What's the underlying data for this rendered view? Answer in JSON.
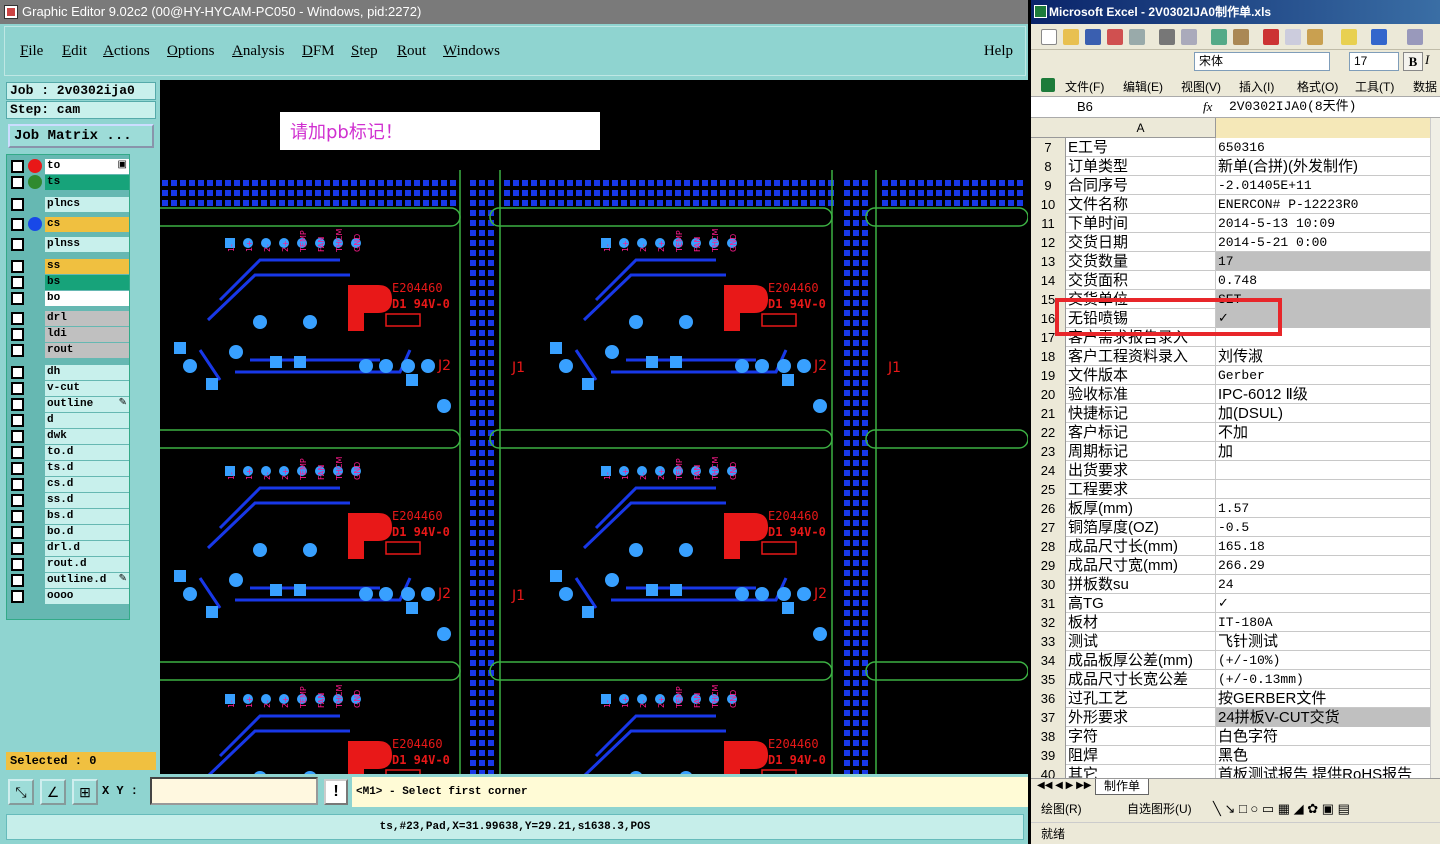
{
  "ge": {
    "title": "Graphic Editor 9.02c2 (00@HY-HYCAM-PC050 - Windows, pid:2272)",
    "menu": [
      "File",
      "Edit",
      "Actions",
      "Options",
      "Analysis",
      "DFM",
      "Step",
      "Rout",
      "Windows"
    ],
    "help": "Help",
    "job": "Job : 2v0302ija0",
    "step": "Step: cam",
    "job_matrix": "Job Matrix ...",
    "layers": [
      {
        "name": "to",
        "color": "#ffffff",
        "dot": "#e81818",
        "mark": "▣"
      },
      {
        "name": "ts",
        "color": "#17a37a",
        "dot": "#2f8a2f",
        "mark": ""
      },
      {
        "name": "plncs",
        "color": "#c8f0ec",
        "dot": "",
        "mark": ""
      },
      {
        "name": "cs",
        "color": "#f0c040",
        "dot": "#1848e8",
        "mark": ""
      },
      {
        "name": "plnss",
        "color": "#c8f0ec",
        "dot": "",
        "mark": ""
      },
      {
        "name": "ss",
        "color": "#f0c040",
        "dot": "",
        "mark": ""
      },
      {
        "name": "bs",
        "color": "#17a37a",
        "dot": "",
        "mark": ""
      },
      {
        "name": "bo",
        "color": "#ffffff",
        "dot": "",
        "mark": ""
      },
      {
        "name": "drl",
        "color": "#c0c0c0",
        "dot": "",
        "mark": ""
      },
      {
        "name": "ldi",
        "color": "#c0c0c0",
        "dot": "",
        "mark": ""
      },
      {
        "name": "rout",
        "color": "#c0c0c0",
        "dot": "",
        "mark": ""
      },
      {
        "name": "dh",
        "color": "#c8f0ec",
        "dot": "",
        "mark": ""
      },
      {
        "name": "v-cut",
        "color": "#c8f0ec",
        "dot": "",
        "mark": ""
      },
      {
        "name": "outline",
        "color": "#c8f0ec",
        "dot": "",
        "mark": "✎"
      },
      {
        "name": "d",
        "color": "#c8f0ec",
        "dot": "",
        "mark": ""
      },
      {
        "name": "dwk",
        "color": "#c8f0ec",
        "dot": "",
        "mark": ""
      },
      {
        "name": "to.d",
        "color": "#c8f0ec",
        "dot": "",
        "mark": ""
      },
      {
        "name": "ts.d",
        "color": "#c8f0ec",
        "dot": "",
        "mark": ""
      },
      {
        "name": "cs.d",
        "color": "#c8f0ec",
        "dot": "",
        "mark": ""
      },
      {
        "name": "ss.d",
        "color": "#c8f0ec",
        "dot": "",
        "mark": ""
      },
      {
        "name": "bs.d",
        "color": "#c8f0ec",
        "dot": "",
        "mark": ""
      },
      {
        "name": "bo.d",
        "color": "#c8f0ec",
        "dot": "",
        "mark": ""
      },
      {
        "name": "drl.d",
        "color": "#c8f0ec",
        "dot": "",
        "mark": ""
      },
      {
        "name": "rout.d",
        "color": "#c8f0ec",
        "dot": "",
        "mark": ""
      },
      {
        "name": "outline.d",
        "color": "#c8f0ec",
        "dot": "",
        "mark": "✎"
      },
      {
        "name": "oooo",
        "color": "#c8f0ec",
        "dot": "",
        "mark": ""
      }
    ],
    "selected": "Selected : 0",
    "note": "请加pb标记！",
    "pcb": {
      "text1": "E204460",
      "text2": "D1 94V-0",
      "j1": "J1",
      "j2": "J2",
      "pins": [
        "1-",
        "1+",
        "2-",
        "2+",
        "TEMP",
        "FAN",
        "THCM",
        "GND"
      ]
    },
    "xy_label": "X Y :",
    "xy_value": "",
    "bang": "!",
    "prompt": "<M1> - Select first corner",
    "status": "ts,#23,Pad,X=31.99638,Y=29.21,s1638.3,POS"
  },
  "xl": {
    "title": "Microsoft Excel - 2V0302IJA0制作单.xls",
    "font_name": "宋体",
    "font_size": "17",
    "bold": "B",
    "italic": "I",
    "menu": [
      "文件(F)",
      "编辑(E)",
      "视图(V)",
      "插入(I)",
      "格式(O)",
      "工具(T)",
      "数据"
    ],
    "name_box": "B6",
    "fx": "fx",
    "formula": "2V0302IJA0(8天件)",
    "col_a": "A",
    "rows": [
      {
        "n": "7",
        "a": "E工号",
        "b": "650316"
      },
      {
        "n": "8",
        "a": "订单类型",
        "b": "新单(合拼)(外发制作)"
      },
      {
        "n": "9",
        "a": "合同序号",
        "b": "-2.01405E+11"
      },
      {
        "n": "10",
        "a": "文件名称",
        "b": "ENERCON# P-12223R0"
      },
      {
        "n": "11",
        "a": "下单时间",
        "b": "2014-5-13 10:09"
      },
      {
        "n": "12",
        "a": "交货日期",
        "b": "2014-5-21 0:00"
      },
      {
        "n": "13",
        "a": "交货数量",
        "b": "17"
      },
      {
        "n": "14",
        "a": "交货面积",
        "b": "0.748"
      },
      {
        "n": "15",
        "a": "交货单位",
        "b": "SET"
      },
      {
        "n": "16",
        "a": "无铅喷锡",
        "b": "✓"
      },
      {
        "n": "17",
        "a": "客户需求报告录入",
        "b": ""
      },
      {
        "n": "18",
        "a": "客户工程资料录入",
        "b": "刘传淑"
      },
      {
        "n": "19",
        "a": "文件版本",
        "b": "Gerber"
      },
      {
        "n": "20",
        "a": "验收标准",
        "b": "IPC-6012 Ⅱ级"
      },
      {
        "n": "21",
        "a": "快捷标记",
        "b": "加(DSUL)"
      },
      {
        "n": "22",
        "a": "客户标记",
        "b": "不加"
      },
      {
        "n": "23",
        "a": "周期标记",
        "b": "加"
      },
      {
        "n": "24",
        "a": "出货要求",
        "b": ""
      },
      {
        "n": "25",
        "a": "工程要求",
        "b": ""
      },
      {
        "n": "26",
        "a": "板厚(mm)",
        "b": "1.57"
      },
      {
        "n": "27",
        "a": "铜箔厚度(OZ)",
        "b": "-0.5"
      },
      {
        "n": "28",
        "a": "成品尺寸长(mm)",
        "b": "165.18"
      },
      {
        "n": "29",
        "a": "成品尺寸宽(mm)",
        "b": "266.29"
      },
      {
        "n": "30",
        "a": "拼板数su",
        "b": "24"
      },
      {
        "n": "31",
        "a": "高TG",
        "b": "✓"
      },
      {
        "n": "32",
        "a": "板材",
        "b": "IT-180A"
      },
      {
        "n": "33",
        "a": "测试",
        "b": "飞针测试"
      },
      {
        "n": "34",
        "a": "成品板厚公差(mm)",
        "b": "(+/-10%)"
      },
      {
        "n": "35",
        "a": "成品尺寸长宽公差",
        "b": "(+/-0.13mm)"
      },
      {
        "n": "36",
        "a": "过孔工艺",
        "b": "按GERBER文件"
      },
      {
        "n": "37",
        "a": "外形要求",
        "b": "24拼板V-CUT交货"
      },
      {
        "n": "38",
        "a": "字符",
        "b": "白色字符"
      },
      {
        "n": "39",
        "a": "阻焊",
        "b": "黑色"
      },
      {
        "n": "40",
        "a": "其它",
        "b": "首板测试报告 提供RoHS报告"
      }
    ],
    "sheet_tab": "制作单",
    "draw_label": "绘图(R)",
    "autoshape_label": "自选图形(U)",
    "status": "就绪"
  }
}
